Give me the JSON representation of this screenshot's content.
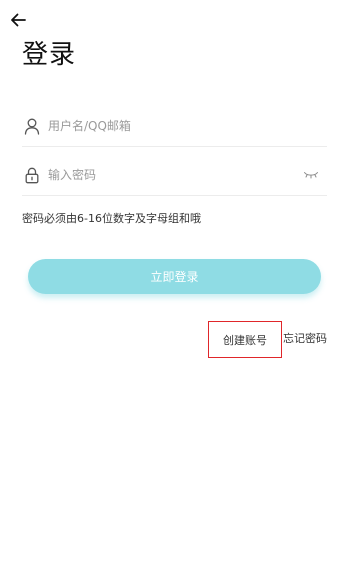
{
  "header": {
    "back_icon": "arrow-left-icon",
    "title": "登录"
  },
  "form": {
    "username": {
      "icon": "user-icon",
      "value": "",
      "placeholder": "用户名/QQ邮箱"
    },
    "password": {
      "icon": "lock-icon",
      "value": "",
      "placeholder": "输入密码",
      "toggle_icon": "eye-closed-icon"
    },
    "hint": "密码必须由6-16位数字及字母组和哦"
  },
  "actions": {
    "login_label": "立即登录",
    "create_account_label": "创建账号",
    "forgot_password_label": "忘记密码"
  },
  "colors": {
    "primary_button": "#8fdce4",
    "highlight_border": "#e0262a",
    "text": "#333333",
    "placeholder": "#9a9a9a"
  }
}
